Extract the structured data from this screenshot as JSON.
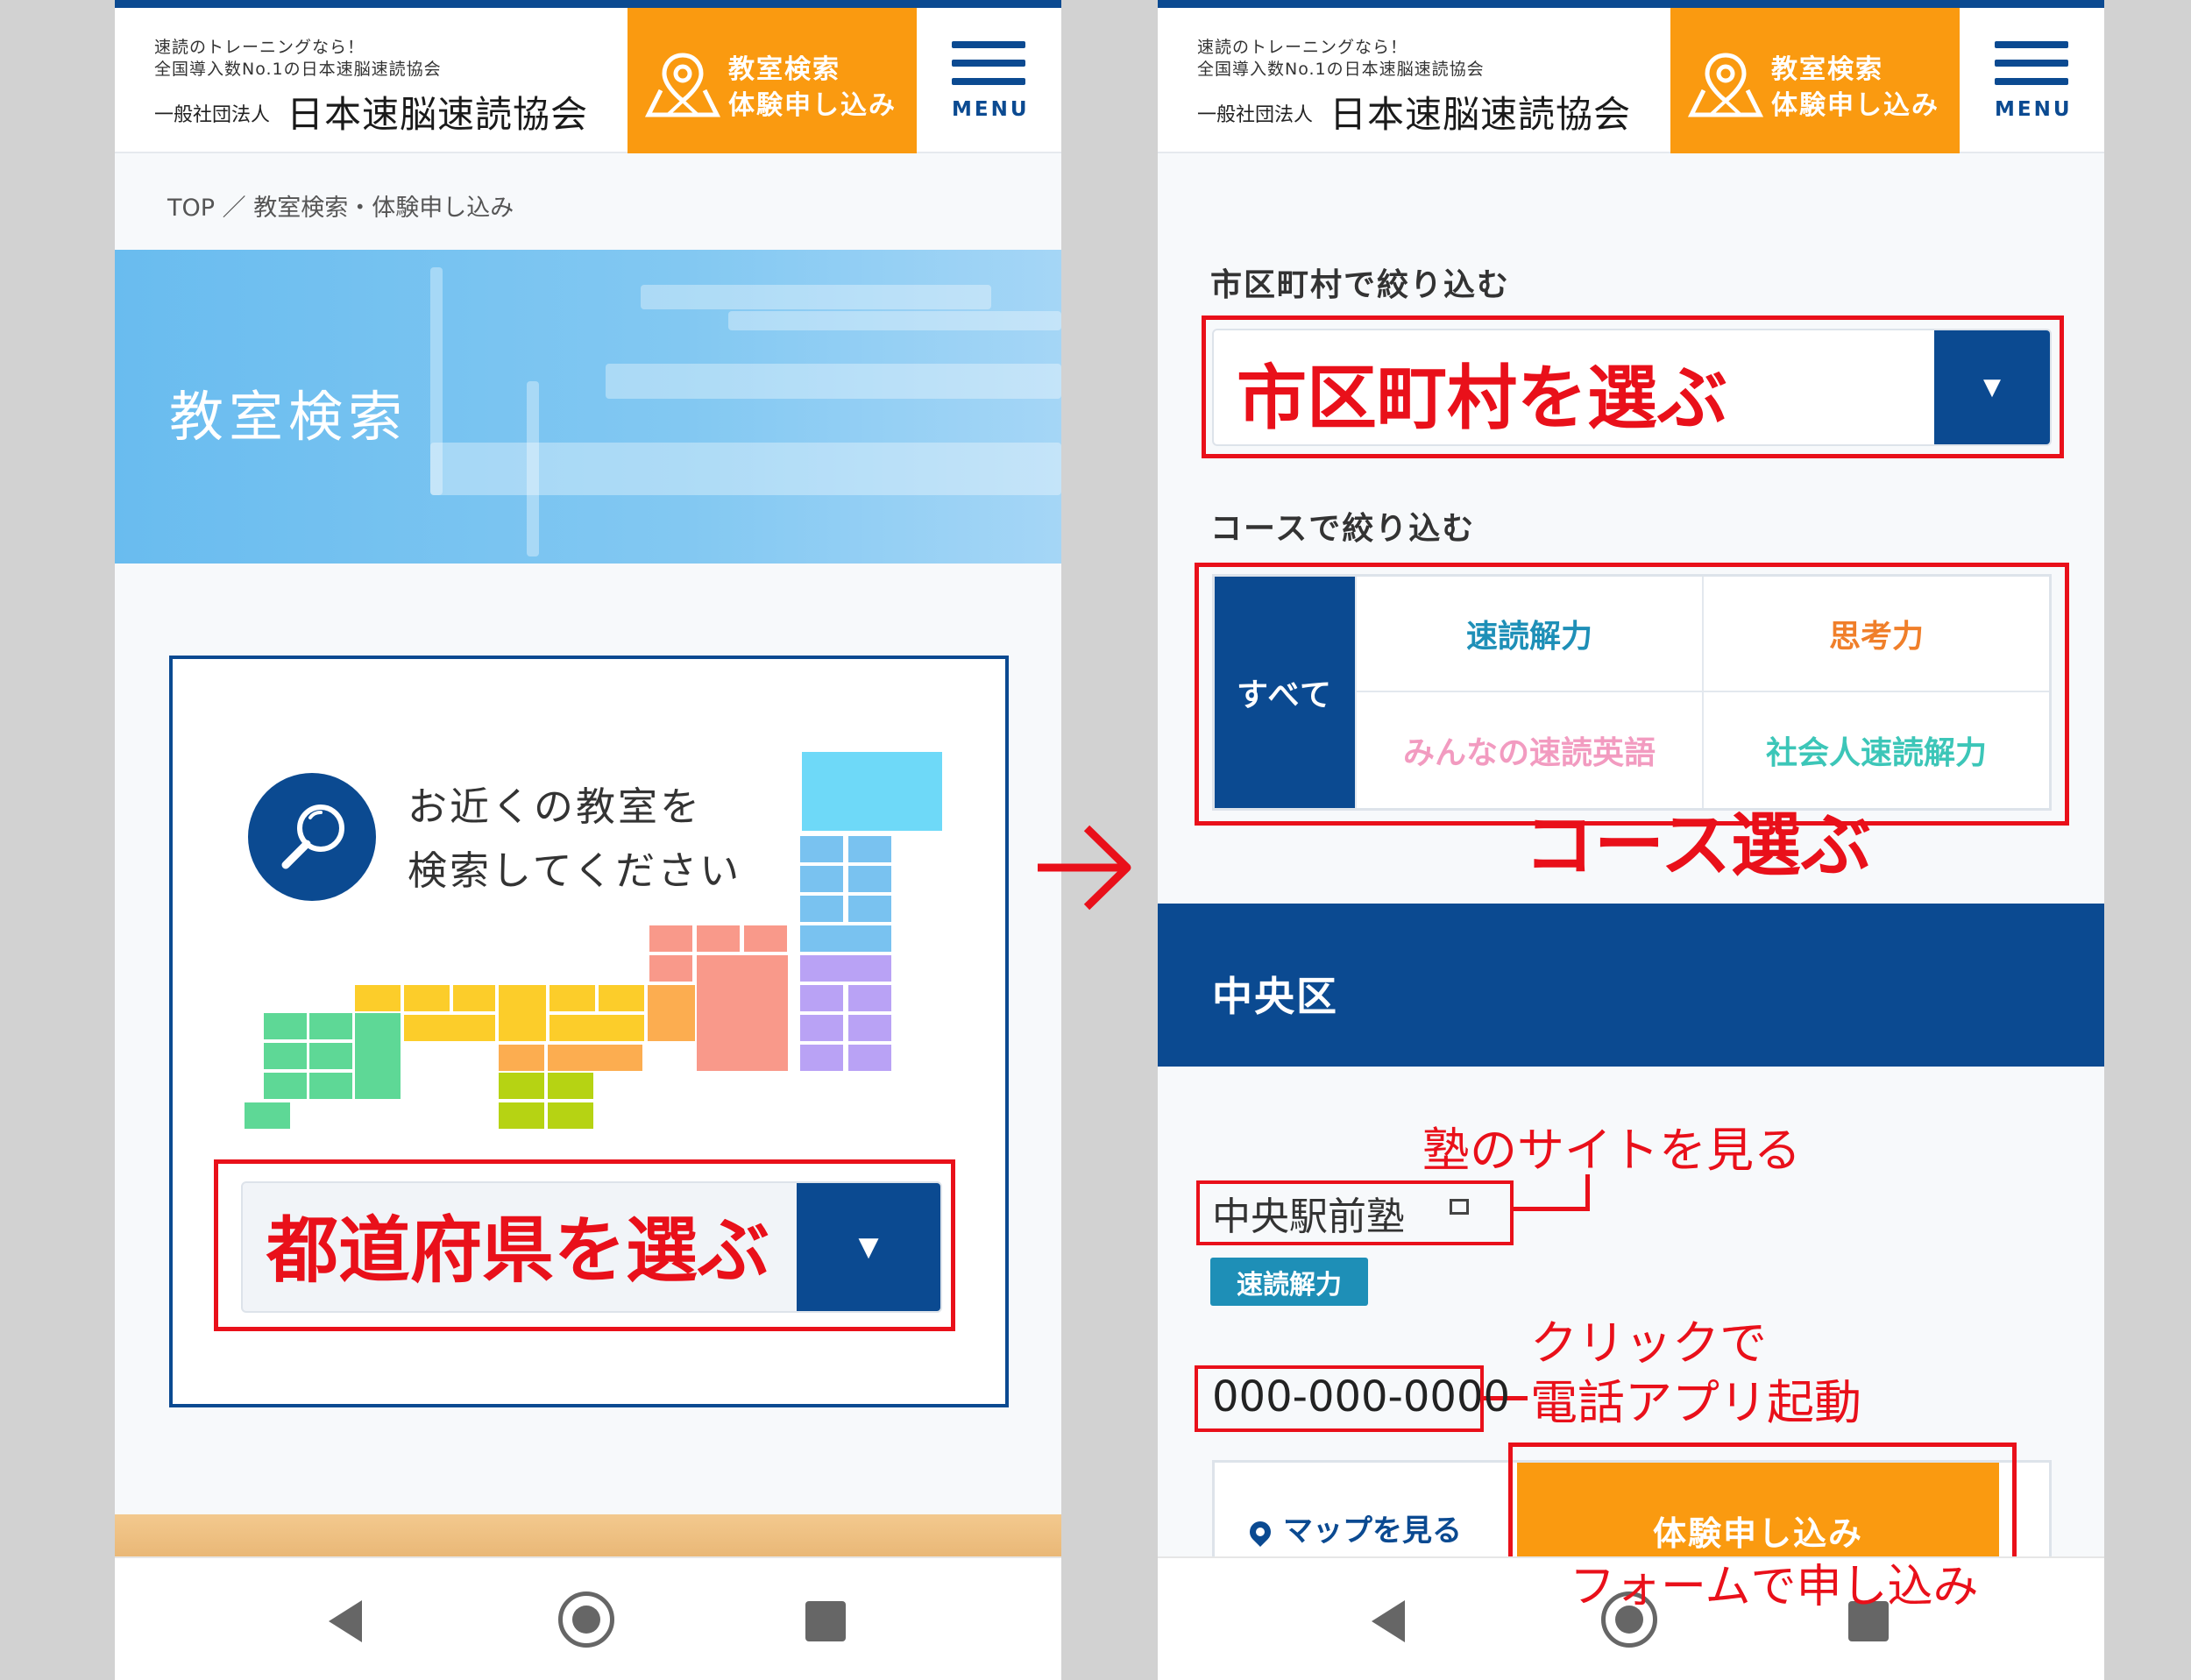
{
  "header": {
    "tagline1": "速読のトレーニングなら！",
    "tagline2": "全国導入数No.1の日本速脳速読協会",
    "org_prefix": "一般社団法人",
    "org_name": "日本速脳速読協会",
    "cta_line1": "教室検索",
    "cta_line2": "体験申し込み",
    "menu_label": "MENU"
  },
  "left_screen": {
    "breadcrumb": "TOP ／ 教室検索・体験申し込み",
    "hero_title": "教室検索",
    "search_line1": "お近くの教室を",
    "search_line2": "検索してください",
    "select_arrow": "▼",
    "callout_prefecture": "都道府県を選ぶ"
  },
  "transition_arrow": "→",
  "right_screen": {
    "city_filter_label": "市区町村で絞り込む",
    "callout_city": "市区町村を選ぶ",
    "select_arrow": "▼",
    "course_filter_label": "コースで絞り込む",
    "course_all": "すべて",
    "courses": [
      "速読解力",
      "思考力",
      "みんなの速読英語",
      "社会人速読解力"
    ],
    "callout_course": "コース選ぶ",
    "ward_name": "中央区",
    "callout_site": "塾のサイトを見る",
    "school_name": "中央駅前塾",
    "school_course_badge": "速読解力",
    "callout_call_line1": "クリックで",
    "callout_call_line2": "電話アプリ起動",
    "phone": "000-000-0000",
    "map_link": "マップを見る",
    "apply_button": "体験申し込み",
    "callout_form": "フォームで申し込み"
  },
  "colors": {
    "brand_navy": "#0b4a91",
    "orange": "#fa9a10",
    "annotation_red": "#e9101a",
    "course_blue": "#1e8fb7",
    "course_orange": "#f07f2a",
    "course_pink": "#f29bc0",
    "course_teal": "#3cc6b8"
  },
  "icons": [
    "map-pin-icon",
    "hamburger-menu-icon",
    "search-magnifier-icon",
    "japan-map-illustration",
    "external-link-icon",
    "nav-back-icon",
    "nav-home-icon",
    "nav-recent-icon"
  ]
}
